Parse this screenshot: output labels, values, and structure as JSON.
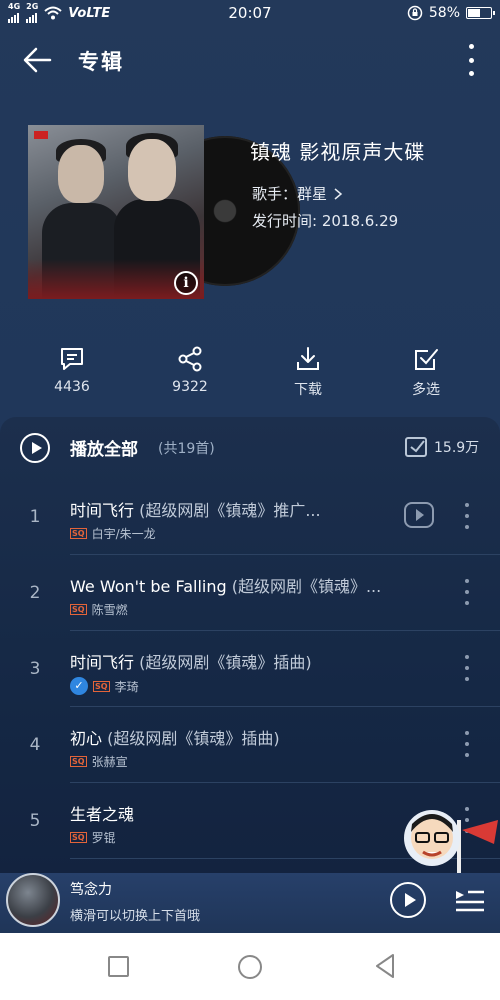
{
  "status_bar": {
    "net_4g": "4G",
    "net_2g": "2G",
    "volte": "VoLTE",
    "time": "20:07",
    "battery_percent": "58%",
    "battery_level": 0.58
  },
  "header": {
    "title": "专辑",
    "back_icon": "arrow-left-icon",
    "more_icon": "more-vertical-icon"
  },
  "album": {
    "title": "镇魂 影视原声大碟",
    "artist_label": "歌手：群星",
    "release_label": "发行时间: 2018.6.29"
  },
  "actions": [
    {
      "label": "4436",
      "icon": "comment-icon"
    },
    {
      "label": "9322",
      "icon": "share-icon"
    },
    {
      "label": "下载",
      "icon": "download-icon"
    },
    {
      "label": "多选",
      "icon": "multi-select-icon"
    }
  ],
  "list": {
    "play_all_label": "播放全部",
    "play_all_count": "(共19首)",
    "favorite_count": "15.9万",
    "tracks": [
      {
        "num": "1",
        "title": "时间飞行",
        "sub": " (超级网剧《镇魂》推广...",
        "badge": "SQ",
        "artist": "白宇/朱一龙",
        "has_video": true,
        "checked": false
      },
      {
        "num": "2",
        "title": "We Won't be Falling",
        "sub": " (超级网剧《镇魂》...",
        "badge": "SQ",
        "artist": "陈雪燃",
        "has_video": false,
        "checked": false
      },
      {
        "num": "3",
        "title": "时间飞行",
        "sub": " (超级网剧《镇魂》插曲)",
        "badge": "SQ",
        "artist": "李琦",
        "has_video": false,
        "checked": true
      },
      {
        "num": "4",
        "title": "初心",
        "sub": " (超级网剧《镇魂》插曲)",
        "badge": "SQ",
        "artist": "张赫宣",
        "has_video": false,
        "checked": false
      },
      {
        "num": "5",
        "title": "生者之魂",
        "sub": "",
        "badge": "SQ",
        "artist": "罗锟",
        "has_video": false,
        "checked": false
      }
    ]
  },
  "mini_player": {
    "title": "笃念力",
    "hint": "横滑可以切换上下首哦"
  },
  "colors": {
    "background": "#20375a",
    "panel": "#152845",
    "sq_badge": "#e3643a",
    "check": "#2f86e0"
  }
}
